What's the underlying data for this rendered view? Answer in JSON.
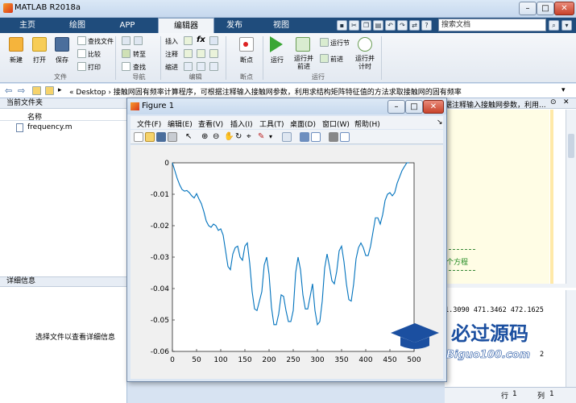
{
  "app": {
    "title": "MATLAB R2018a",
    "tabs": [
      "主页",
      "绘图",
      "APP",
      "编辑器",
      "发布",
      "视图"
    ],
    "active_tab": "编辑器",
    "search_placeholder": "搜索文档"
  },
  "ribbon": {
    "file_group": {
      "label": "文件",
      "new": "新建",
      "open": "打开",
      "save": "保存",
      "find_file": "查找文件",
      "compare": "比较",
      "print": "打印"
    },
    "nav_group": {
      "label": "导航",
      "goto": "转至",
      "find": "查找"
    },
    "edit_group": {
      "label": "编辑",
      "insert": "插入",
      "comment": "注释",
      "indent": "缩进",
      "fx": "fx"
    },
    "breakpoint_group": {
      "label": "断点",
      "breakpoints": "断点"
    },
    "run_group": {
      "label": "运行",
      "run": "运行",
      "run_advance": "运行并\n前进",
      "run_section": "运行节",
      "advance": "前进",
      "run_time": "运行并\n计时"
    }
  },
  "addressbar": {
    "path": "« Desktop › 接触网固有频率计算程序，可根据注释输入接触网参数，利用求结构矩阵特征值的方法求取接触网的固有频率"
  },
  "left_panel": {
    "current_folder_title": "当前文件夹",
    "name_header": "名称",
    "files": [
      "frequency.m"
    ],
    "details_title": "详细信息",
    "details_hint": "选择文件以查看详细信息"
  },
  "editor_snippet": "据注释输入接触网参数，利用...",
  "editor_comment": "个方程",
  "cmd": {
    "values": "1.3090   471.3462   472.1625",
    "trailing": "2"
  },
  "status": {
    "row_label": "行",
    "row_value": "1",
    "col_label": "列",
    "col_value": "1"
  },
  "figure": {
    "title": "Figure 1",
    "menu": [
      "文件(F)",
      "编辑(E)",
      "查看(V)",
      "插入(I)",
      "工具(T)",
      "桌面(D)",
      "窗口(W)",
      "帮助(H)"
    ]
  },
  "chart_data": {
    "type": "line",
    "xlim": [
      0,
      500
    ],
    "ylim": [
      -0.06,
      0
    ],
    "xticks": [
      0,
      50,
      100,
      150,
      200,
      250,
      300,
      350,
      400,
      450,
      500
    ],
    "yticks": [
      0,
      -0.01,
      -0.02,
      -0.03,
      -0.04,
      -0.05,
      -0.06
    ],
    "line_color": "#0072bd",
    "grid": false,
    "series": [
      {
        "x": [
          0,
          5,
          10,
          15,
          20,
          25,
          30,
          35,
          40,
          45,
          50,
          55,
          60,
          65,
          70,
          75,
          80,
          85,
          90,
          95,
          100,
          105,
          110,
          115,
          120,
          125,
          130,
          135,
          140,
          145,
          150,
          155,
          160,
          165,
          170,
          175,
          180,
          185,
          190,
          195,
          200,
          205,
          210,
          215,
          220,
          225,
          230,
          235,
          240,
          245,
          250,
          255,
          260,
          265,
          270,
          275,
          280,
          285,
          290,
          295,
          300,
          305,
          310,
          315,
          320,
          325,
          330,
          335,
          340,
          345,
          350,
          355,
          360,
          365,
          370,
          375,
          380,
          385,
          390,
          395,
          400,
          405,
          410,
          415,
          420,
          425,
          430,
          435,
          440,
          445,
          450,
          455,
          460,
          465,
          470,
          475,
          480,
          485,
          490
        ],
        "y": [
          0,
          -0.0025,
          -0.005,
          -0.007,
          -0.0085,
          -0.009,
          -0.0088,
          -0.0095,
          -0.0105,
          -0.0112,
          -0.0098,
          -0.0115,
          -0.013,
          -0.0155,
          -0.0185,
          -0.02,
          -0.0205,
          -0.0195,
          -0.02,
          -0.0215,
          -0.021,
          -0.023,
          -0.028,
          -0.033,
          -0.034,
          -0.029,
          -0.027,
          -0.0265,
          -0.03,
          -0.031,
          -0.0265,
          -0.0255,
          -0.032,
          -0.041,
          -0.0465,
          -0.047,
          -0.044,
          -0.041,
          -0.0325,
          -0.03,
          -0.0355,
          -0.046,
          -0.0515,
          -0.0515,
          -0.048,
          -0.042,
          -0.0425,
          -0.047,
          -0.0505,
          -0.0505,
          -0.047,
          -0.035,
          -0.03,
          -0.034,
          -0.042,
          -0.0465,
          -0.0465,
          -0.0425,
          -0.0385,
          -0.047,
          -0.0515,
          -0.0505,
          -0.044,
          -0.0335,
          -0.029,
          -0.033,
          -0.0375,
          -0.0385,
          -0.0345,
          -0.028,
          -0.0265,
          -0.0315,
          -0.0385,
          -0.0435,
          -0.044,
          -0.0385,
          -0.0305,
          -0.027,
          -0.0255,
          -0.027,
          -0.0295,
          -0.0295,
          -0.0265,
          -0.022,
          -0.0175,
          -0.0175,
          -0.0195,
          -0.0165,
          -0.012,
          -0.01,
          -0.0095,
          -0.0105,
          -0.0095,
          -0.0065,
          -0.0045,
          -0.0025,
          -0.0012,
          0,
          0
        ]
      }
    ]
  },
  "watermark": {
    "title": "必过源码",
    "url": "Biguo100.com"
  }
}
